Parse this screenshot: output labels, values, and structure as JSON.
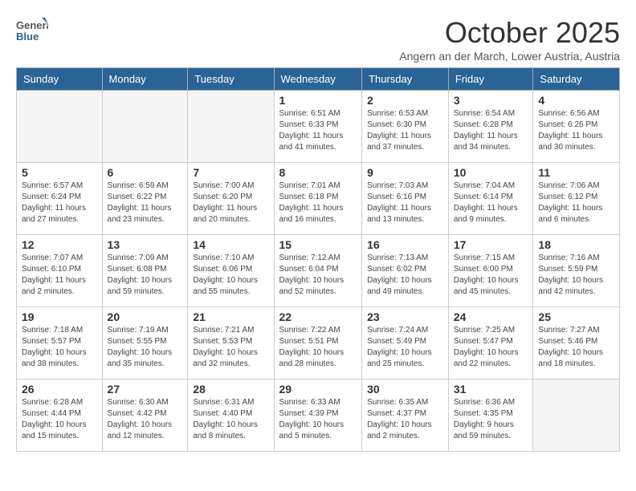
{
  "header": {
    "logo_general": "General",
    "logo_blue": "Blue",
    "month_title": "October 2025",
    "location": "Angern an der March, Lower Austria, Austria"
  },
  "days_of_week": [
    "Sunday",
    "Monday",
    "Tuesday",
    "Wednesday",
    "Thursday",
    "Friday",
    "Saturday"
  ],
  "weeks": [
    [
      {
        "day": "",
        "info": ""
      },
      {
        "day": "",
        "info": ""
      },
      {
        "day": "",
        "info": ""
      },
      {
        "day": "1",
        "info": "Sunrise: 6:51 AM\nSunset: 6:33 PM\nDaylight: 11 hours\nand 41 minutes."
      },
      {
        "day": "2",
        "info": "Sunrise: 6:53 AM\nSunset: 6:30 PM\nDaylight: 11 hours\nand 37 minutes."
      },
      {
        "day": "3",
        "info": "Sunrise: 6:54 AM\nSunset: 6:28 PM\nDaylight: 11 hours\nand 34 minutes."
      },
      {
        "day": "4",
        "info": "Sunrise: 6:56 AM\nSunset: 6:26 PM\nDaylight: 11 hours\nand 30 minutes."
      }
    ],
    [
      {
        "day": "5",
        "info": "Sunrise: 6:57 AM\nSunset: 6:24 PM\nDaylight: 11 hours\nand 27 minutes."
      },
      {
        "day": "6",
        "info": "Sunrise: 6:59 AM\nSunset: 6:22 PM\nDaylight: 11 hours\nand 23 minutes."
      },
      {
        "day": "7",
        "info": "Sunrise: 7:00 AM\nSunset: 6:20 PM\nDaylight: 11 hours\nand 20 minutes."
      },
      {
        "day": "8",
        "info": "Sunrise: 7:01 AM\nSunset: 6:18 PM\nDaylight: 11 hours\nand 16 minutes."
      },
      {
        "day": "9",
        "info": "Sunrise: 7:03 AM\nSunset: 6:16 PM\nDaylight: 11 hours\nand 13 minutes."
      },
      {
        "day": "10",
        "info": "Sunrise: 7:04 AM\nSunset: 6:14 PM\nDaylight: 11 hours\nand 9 minutes."
      },
      {
        "day": "11",
        "info": "Sunrise: 7:06 AM\nSunset: 6:12 PM\nDaylight: 11 hours\nand 6 minutes."
      }
    ],
    [
      {
        "day": "12",
        "info": "Sunrise: 7:07 AM\nSunset: 6:10 PM\nDaylight: 11 hours\nand 2 minutes."
      },
      {
        "day": "13",
        "info": "Sunrise: 7:09 AM\nSunset: 6:08 PM\nDaylight: 10 hours\nand 59 minutes."
      },
      {
        "day": "14",
        "info": "Sunrise: 7:10 AM\nSunset: 6:06 PM\nDaylight: 10 hours\nand 55 minutes."
      },
      {
        "day": "15",
        "info": "Sunrise: 7:12 AM\nSunset: 6:04 PM\nDaylight: 10 hours\nand 52 minutes."
      },
      {
        "day": "16",
        "info": "Sunrise: 7:13 AM\nSunset: 6:02 PM\nDaylight: 10 hours\nand 49 minutes."
      },
      {
        "day": "17",
        "info": "Sunrise: 7:15 AM\nSunset: 6:00 PM\nDaylight: 10 hours\nand 45 minutes."
      },
      {
        "day": "18",
        "info": "Sunrise: 7:16 AM\nSunset: 5:59 PM\nDaylight: 10 hours\nand 42 minutes."
      }
    ],
    [
      {
        "day": "19",
        "info": "Sunrise: 7:18 AM\nSunset: 5:57 PM\nDaylight: 10 hours\nand 38 minutes."
      },
      {
        "day": "20",
        "info": "Sunrise: 7:19 AM\nSunset: 5:55 PM\nDaylight: 10 hours\nand 35 minutes."
      },
      {
        "day": "21",
        "info": "Sunrise: 7:21 AM\nSunset: 5:53 PM\nDaylight: 10 hours\nand 32 minutes."
      },
      {
        "day": "22",
        "info": "Sunrise: 7:22 AM\nSunset: 5:51 PM\nDaylight: 10 hours\nand 28 minutes."
      },
      {
        "day": "23",
        "info": "Sunrise: 7:24 AM\nSunset: 5:49 PM\nDaylight: 10 hours\nand 25 minutes."
      },
      {
        "day": "24",
        "info": "Sunrise: 7:25 AM\nSunset: 5:47 PM\nDaylight: 10 hours\nand 22 minutes."
      },
      {
        "day": "25",
        "info": "Sunrise: 7:27 AM\nSunset: 5:46 PM\nDaylight: 10 hours\nand 18 minutes."
      }
    ],
    [
      {
        "day": "26",
        "info": "Sunrise: 6:28 AM\nSunset: 4:44 PM\nDaylight: 10 hours\nand 15 minutes."
      },
      {
        "day": "27",
        "info": "Sunrise: 6:30 AM\nSunset: 4:42 PM\nDaylight: 10 hours\nand 12 minutes."
      },
      {
        "day": "28",
        "info": "Sunrise: 6:31 AM\nSunset: 4:40 PM\nDaylight: 10 hours\nand 8 minutes."
      },
      {
        "day": "29",
        "info": "Sunrise: 6:33 AM\nSunset: 4:39 PM\nDaylight: 10 hours\nand 5 minutes."
      },
      {
        "day": "30",
        "info": "Sunrise: 6:35 AM\nSunset: 4:37 PM\nDaylight: 10 hours\nand 2 minutes."
      },
      {
        "day": "31",
        "info": "Sunrise: 6:36 AM\nSunset: 4:35 PM\nDaylight: 9 hours\nand 59 minutes."
      },
      {
        "day": "",
        "info": ""
      }
    ]
  ]
}
